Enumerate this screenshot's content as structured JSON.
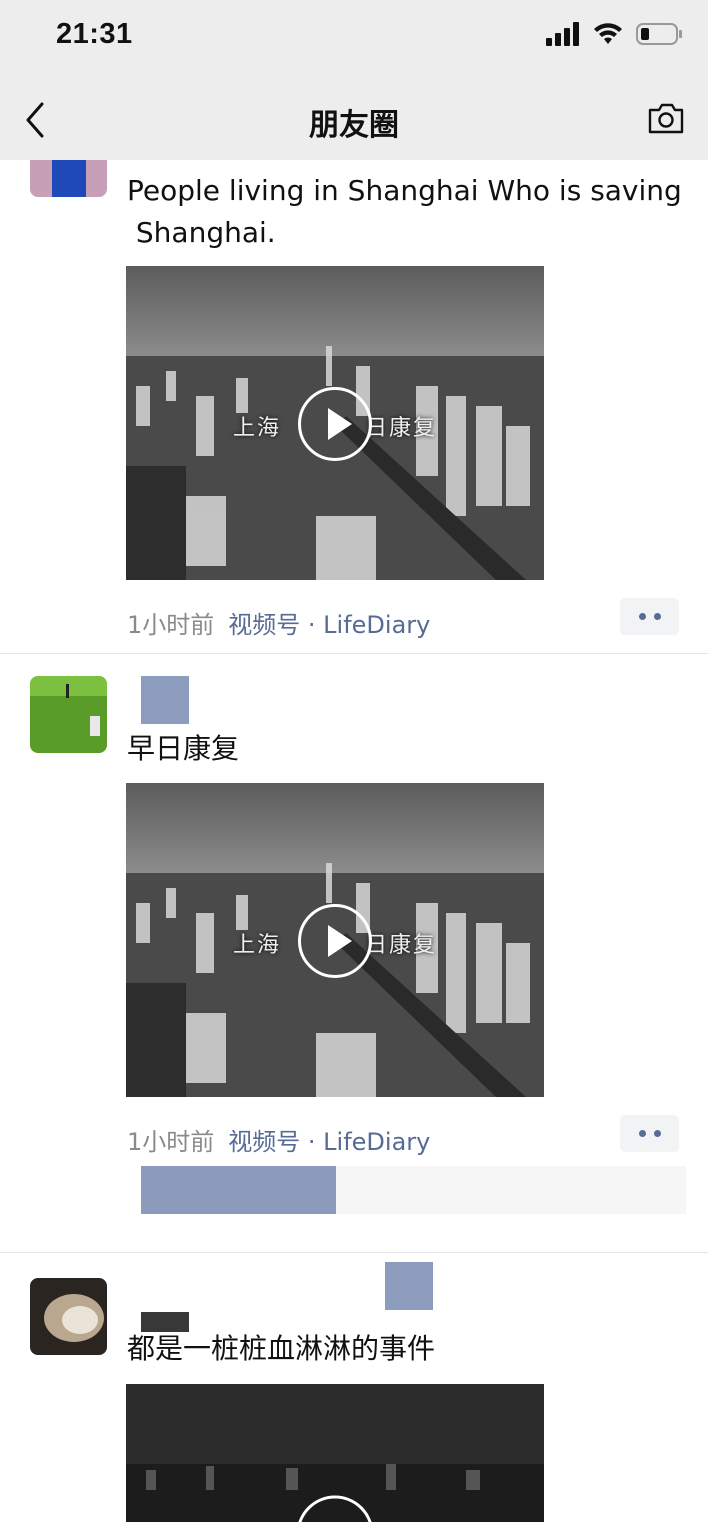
{
  "status_bar": {
    "time": "21:31"
  },
  "nav": {
    "title": "朋友圈"
  },
  "posts": [
    {
      "text_line1": "People living in Shanghai Who is saving",
      "text_line2": " Shanghai.",
      "video_caption_left": "上海",
      "video_caption_right": "日康复",
      "time": "1小时前",
      "source": "视频号 · LifeDiary"
    },
    {
      "text": "早日康复",
      "video_caption_left": "上海",
      "video_caption_right": "日康复",
      "time": "1小时前",
      "source": "视频号 · LifeDiary"
    },
    {
      "text": "都是一桩桩血淋淋的事件"
    }
  ],
  "icons": {
    "back": "back-chevron-icon",
    "camera": "camera-icon",
    "signal": "signal-icon",
    "wifi": "wifi-icon",
    "battery": "battery-icon"
  },
  "colors": {
    "link": "#576b95",
    "nav_bg": "#ededed",
    "meta_gray": "#8a8a8a"
  }
}
